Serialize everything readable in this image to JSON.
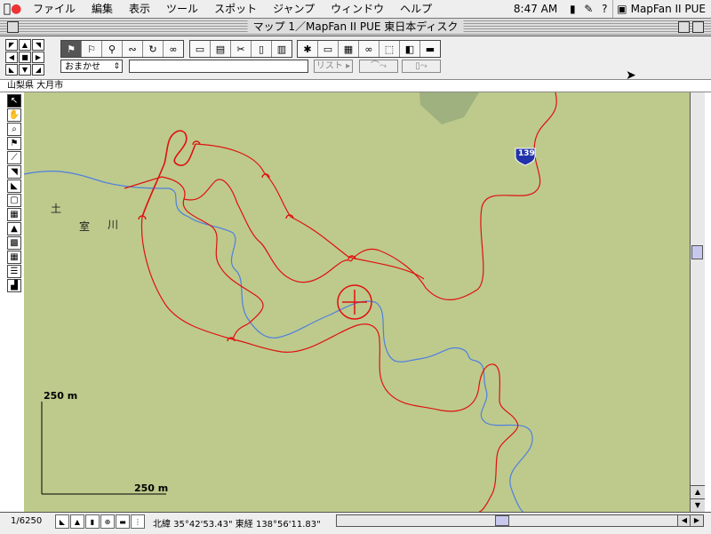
{
  "menubar": {
    "apple": "",
    "items": [
      "ファイル",
      "編集",
      "表示",
      "ツール",
      "スポット",
      "ジャンプ",
      "ウィンドウ",
      "ヘルプ"
    ],
    "clock": "8:47 AM",
    "app_name": "MapFan II PUE"
  },
  "window": {
    "title": "マップ 1／MapFan II PUE 東日本ディスク"
  },
  "toolbar": {
    "mode_select": "おまかせ",
    "search_value": "",
    "list_button": "リスト"
  },
  "location": {
    "breadcrumb": "山梨県 大月市"
  },
  "map": {
    "labels": [
      "土",
      "室",
      "川"
    ],
    "route_marker": "139",
    "scale_vertical": "250 m",
    "scale_horizontal": "250 m",
    "colors": {
      "background": "#bdca8c",
      "road": "#e01010",
      "river": "#4f7fe0",
      "field": "#9aaf7a"
    }
  },
  "status": {
    "scale": "1/6250",
    "coords": "北緯 35°42'53.43\"  東経 138°56'11.83\""
  }
}
